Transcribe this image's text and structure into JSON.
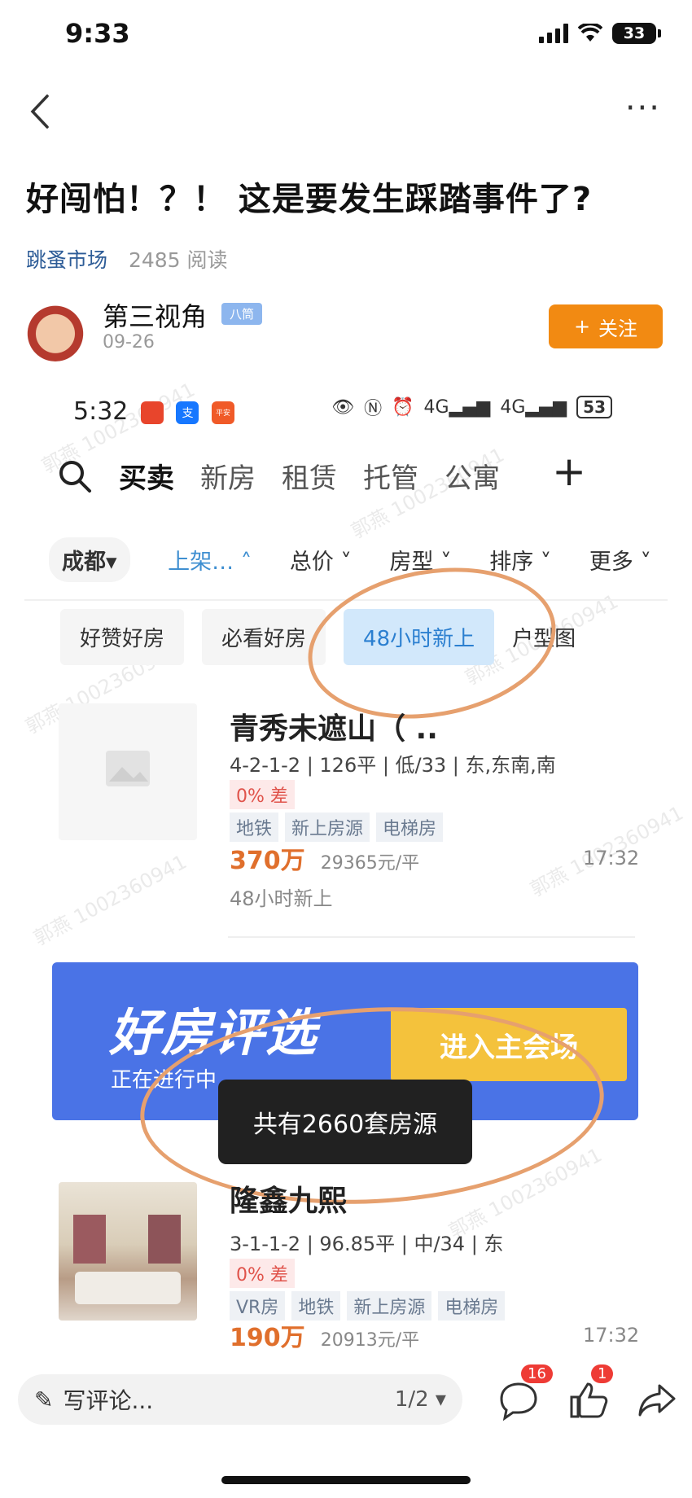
{
  "status_bar": {
    "time": "9:33",
    "battery": "33"
  },
  "article": {
    "title": "好闯怕！？！ 这是要发生踩踏事件了?",
    "channel": "跳蚤市场",
    "reads": "2485 阅读",
    "author": "第三视角",
    "author_badge": "八筒",
    "date": "09-26",
    "follow_label": "关注"
  },
  "embedded": {
    "status_time": "5:32",
    "status_battery": "53",
    "app_labels": [
      "支",
      "平安"
    ],
    "tabs": [
      "买卖",
      "新房",
      "租赁",
      "托管",
      "公寓"
    ],
    "filters": [
      "成都",
      "上架…",
      "总价",
      "房型",
      "排序",
      "更多"
    ],
    "chips": [
      "好赞好房",
      "必看好房",
      "48小时新上",
      "户型图"
    ],
    "listing1": {
      "name": "青秀未遮山（ ..",
      "desc": "4-2-1-2 | 126平 | 低/33 | 东,东南,南",
      "diff": "0% 差",
      "tags": [
        "地铁",
        "新上房源",
        "电梯房"
      ],
      "price": "370万",
      "unit_price": "29365元/平",
      "time": "17:32",
      "note": "48小时新上"
    },
    "banner": {
      "title": "好房评选",
      "subtitle": "正在进行中",
      "button": "进入主会场"
    },
    "toast": "共有2660套房源",
    "listing2": {
      "name": "隆鑫九熙",
      "desc": "3-1-1-2 | 96.85平 | 中/34 | 东",
      "diff": "0% 差",
      "tags": [
        "VR房",
        "地铁",
        "新上房源",
        "电梯房"
      ],
      "price": "190万",
      "unit_price": "20913元/平",
      "time": "17:32"
    },
    "watermark": "郭燕 1002360941"
  },
  "bottom_bar": {
    "comment_placeholder": "写评论...",
    "page": "1/2",
    "comment_count": "16",
    "like_count": "1"
  },
  "colors": {
    "accent": "#f28a12",
    "link": "#2d5c97",
    "price": "#e06f2c",
    "highlight_circle": "#e6a06e"
  }
}
